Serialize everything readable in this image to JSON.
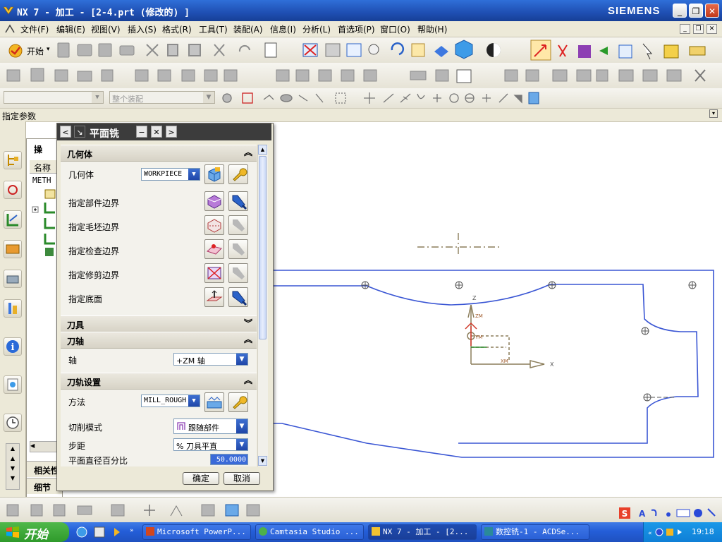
{
  "window": {
    "title": "NX 7 - 加工 - [2-4.prt  (修改的) ]",
    "brand": "SIEMENS",
    "min_label": "_",
    "max_label": "❐",
    "close_label": "✕"
  },
  "menu": {
    "items": [
      "文件(F)",
      "编辑(E)",
      "视图(V)",
      "插入(S)",
      "格式(R)",
      "工具(T)",
      "装配(A)",
      "信息(I)",
      "分析(L)",
      "首选项(P)",
      "窗口(O)",
      "帮助(H)"
    ]
  },
  "toolbar": {
    "start_label": "开始",
    "assembly_placeholder": "整个装配"
  },
  "status": {
    "text": "指定参数"
  },
  "navigator": {
    "header_initial": "操",
    "col_name": "名称",
    "root": "METH",
    "tabs": [
      "相关性",
      "细节"
    ]
  },
  "dialog": {
    "title": "平面铣",
    "groups": {
      "geometry": "几何体",
      "tool": "刀具",
      "tool_axis": "刀轴",
      "path_settings": "刀轨设置"
    },
    "geometry_label": "几何体",
    "geometry_value": "WORKPIECE",
    "boundaries": [
      "指定部件边界",
      "指定毛坯边界",
      "指定检查边界",
      "指定修剪边界",
      "指定底面"
    ],
    "axis_label": "轴",
    "axis_value": "+ZM 轴",
    "method_label": "方法",
    "method_value": "MILL_ROUGH",
    "cut_mode_label": "切削模式",
    "cut_mode_value": "跟随部件",
    "stepover_label": "步距",
    "stepover_value": "% 刀具平直",
    "percent_label": "平面直径百分比",
    "percent_value": "50.0000",
    "ok": "确定",
    "cancel": "取消"
  },
  "graphics": {
    "axis_z": "Z",
    "axis_x": "X",
    "axis_y": "YM",
    "axis_xm": "XM",
    "axis_zm": "ZM"
  },
  "taskbar": {
    "start": "开始",
    "tasks": [
      "Microsoft PowerP...",
      "Camtasia Studio ...",
      "NX 7 - 加工 - [2...",
      "数控铣-1 - ACDSe..."
    ],
    "clock": "19:18"
  },
  "colors": {
    "title_blue": "#1f4fb3",
    "part_outline": "#3355dd",
    "wcs_color": "#8b7d5a"
  }
}
